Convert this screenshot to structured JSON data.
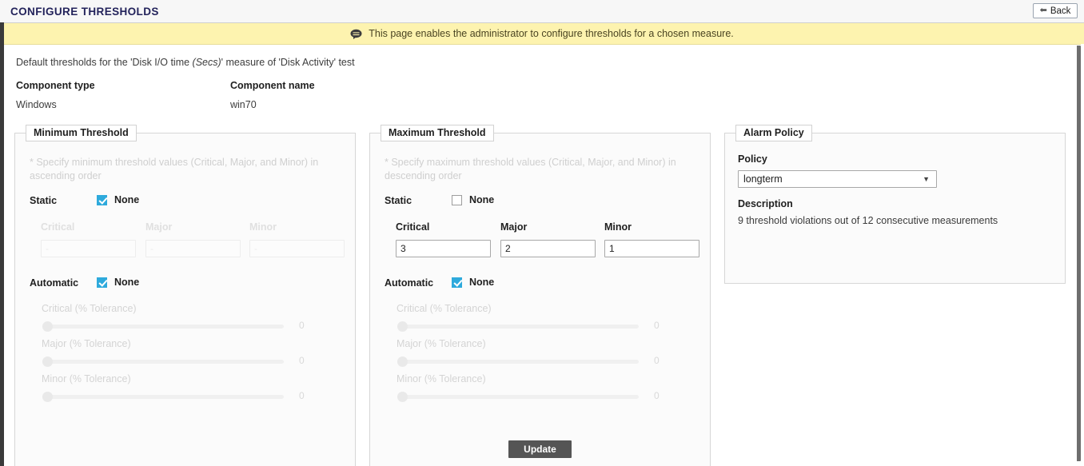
{
  "titlebar": {
    "title": "CONFIGURE THRESHOLDS",
    "back_label": "Back",
    "back_icon": "left-arrow-icon"
  },
  "notice": {
    "icon": "speech-bubble-icon",
    "text": "This page enables the administrator to configure thresholds for a chosen measure."
  },
  "summary": {
    "measure_prefix": "Default thresholds for the 'Disk I/O time ",
    "measure_unit": "(Secs)",
    "measure_suffix": "' measure of 'Disk Activity' test",
    "component_type_label": "Component type",
    "component_type_value": "Windows",
    "component_name_label": "Component name",
    "component_name_value": "win70"
  },
  "minimum_threshold": {
    "legend": "Minimum Threshold",
    "hint": "* Specify minimum threshold values (Critical, Major, and Minor) in ascending order",
    "static": {
      "label": "Static",
      "none_label": "None",
      "checked": true,
      "critical_label": "Critical",
      "major_label": "Major",
      "minor_label": "Minor",
      "critical_value": "-",
      "major_value": "-",
      "minor_value": "-"
    },
    "automatic": {
      "label": "Automatic",
      "none_label": "None",
      "checked": true,
      "critical_label": "Critical (% Tolerance)",
      "critical_value": "0",
      "major_label": "Major (% Tolerance)",
      "major_value": "0",
      "minor_label": "Minor (% Tolerance)",
      "minor_value": "0"
    }
  },
  "maximum_threshold": {
    "legend": "Maximum Threshold",
    "hint": "* Specify maximum threshold values (Critical, Major, and Minor) in descending order",
    "static": {
      "label": "Static",
      "none_label": "None",
      "checked": false,
      "critical_label": "Critical",
      "major_label": "Major",
      "minor_label": "Minor",
      "critical_value": "3",
      "major_value": "2",
      "minor_value": "1"
    },
    "automatic": {
      "label": "Automatic",
      "none_label": "None",
      "checked": true,
      "critical_label": "Critical (% Tolerance)",
      "critical_value": "0",
      "major_label": "Major (% Tolerance)",
      "major_value": "0",
      "minor_label": "Minor (% Tolerance)",
      "minor_value": "0"
    }
  },
  "alarm_policy": {
    "legend": "Alarm Policy",
    "policy_label": "Policy",
    "policy_value": "longterm",
    "description_label": "Description",
    "description_value": "9 threshold violations out of 12 consecutive measurements"
  },
  "footer": {
    "update_label": "Update"
  },
  "colors": {
    "checkbox_accent": "#2eaadc",
    "notice_background": "#fdf3af",
    "update_button": "#555555"
  }
}
